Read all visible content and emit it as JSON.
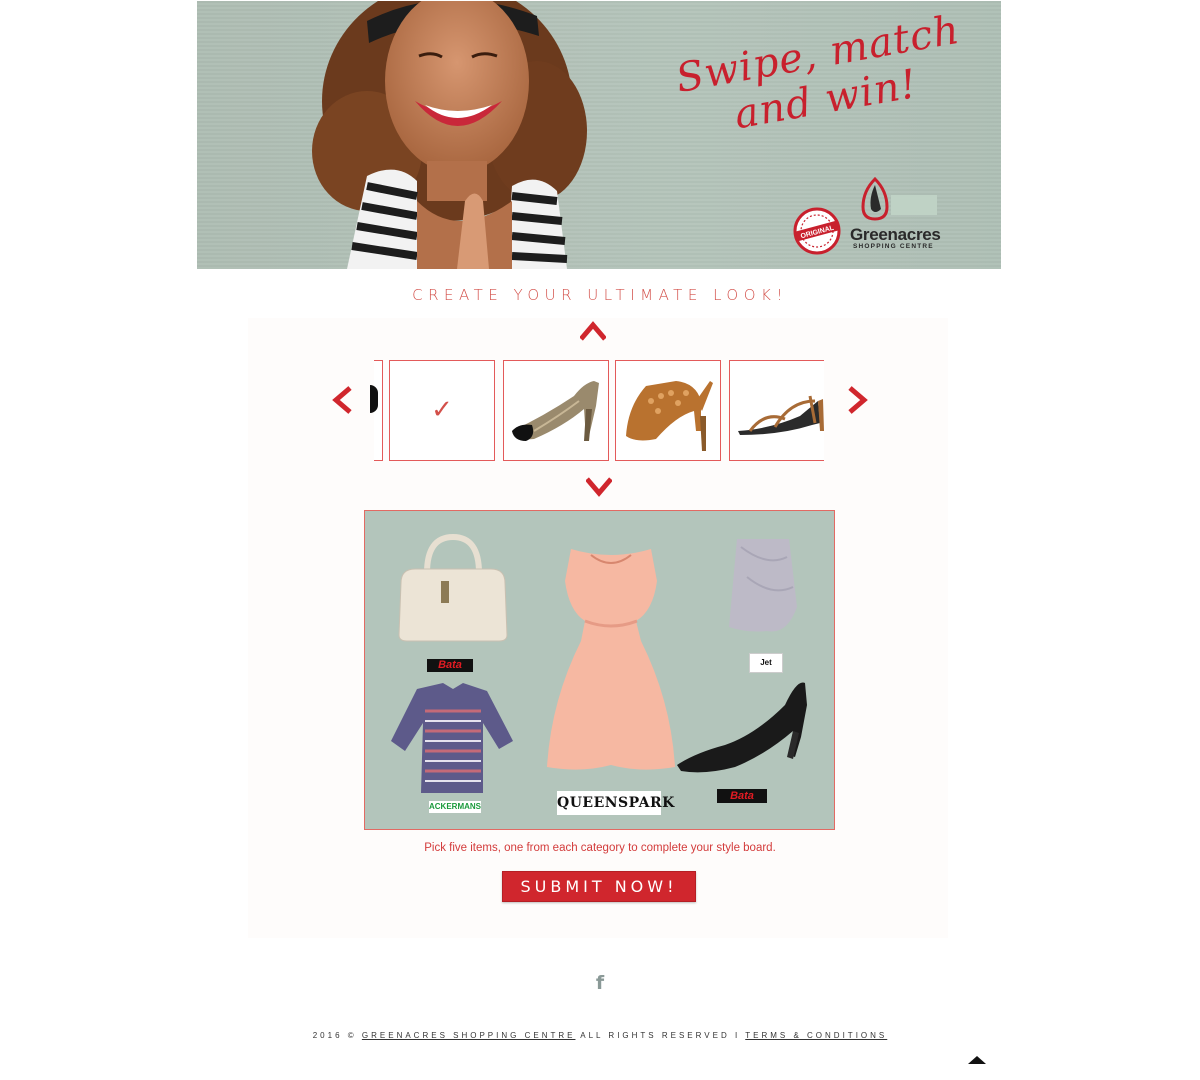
{
  "banner": {
    "slogan_line1": "Swipe, match",
    "slogan_line2": "and win!",
    "logo_brand": "Greenacres",
    "logo_sub": "SHOPPING CENTRE",
    "seal_text": "ORIGINAL"
  },
  "page_title": "CREATE YOUR ULTIMATE LOOK!",
  "carousel": {
    "up_icon": "chevron-up-icon",
    "down_icon": "chevron-down-icon",
    "prev_icon": "chevron-left-icon",
    "next_icon": "chevron-right-icon",
    "selected_mark": "✓",
    "items": [
      "selected",
      "snakeskin-pump",
      "tan-cutout-heel",
      "strappy-sandal"
    ]
  },
  "board": {
    "labels": {
      "bag_brand": "Bata",
      "skirt_brand": "Jet",
      "shirt_brand": "ACKERMANS",
      "dress_brand": "QUEENSPARK",
      "shoe_brand": "Bata"
    }
  },
  "instruction": "Pick five items, one from each category to complete your style board.",
  "submit_label": "SUBMIT NOW!",
  "footer": {
    "year_text": "2016 ©",
    "company_link": "GREENACRES SHOPPING CENTRE",
    "rights_text": "ALL RIGHTS RESERVED I",
    "terms_link": "TERMS & CONDITIONS"
  },
  "colors": {
    "accent_red": "#d0262d",
    "board_bg": "#b3c5bb",
    "banner_bg": "#b4c4ba"
  }
}
